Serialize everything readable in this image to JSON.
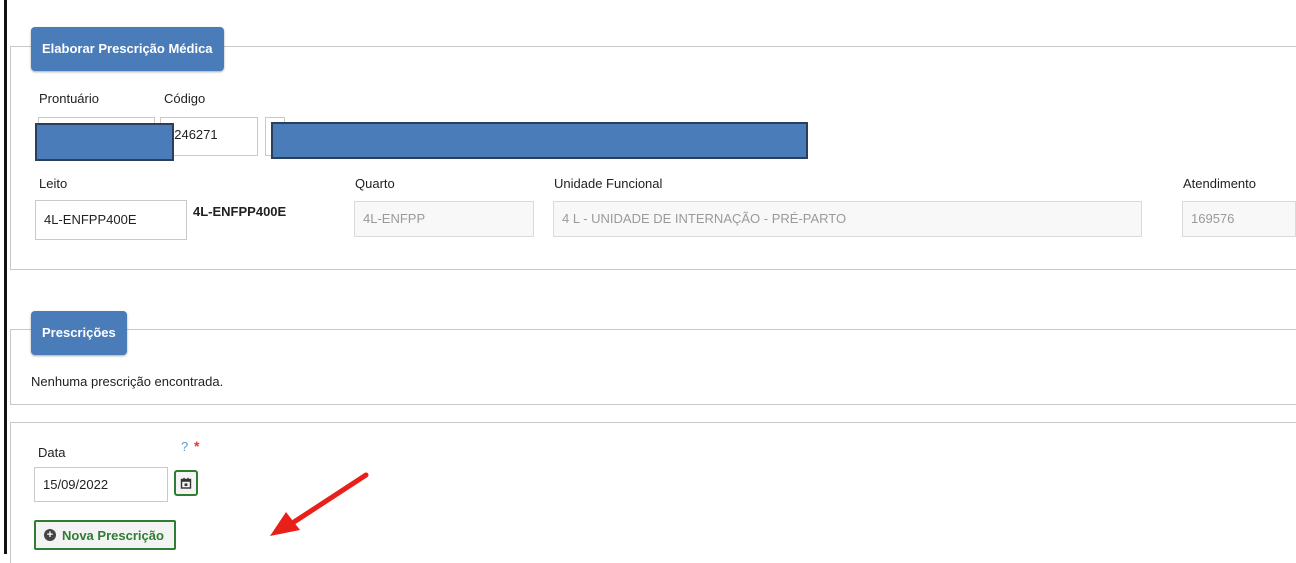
{
  "header": {
    "title": "Elaborar Prescrição Médica"
  },
  "patient": {
    "prontuario_label": "Prontuário",
    "codigo_label": "Código",
    "codigo_value": "3246271"
  },
  "bed": {
    "leito_label": "Leito",
    "leito_value": "4L-ENFPP400E",
    "leito_desc": "4L-ENFPP400E",
    "quarto_label": "Quarto",
    "quarto_value": "4L-ENFPP",
    "unidade_label": "Unidade Funcional",
    "unidade_value": "4 L - UNIDADE DE INTERNAÇÃO - PRÉ-PARTO",
    "atendimento_label": "Atendimento",
    "atendimento_value": "169576"
  },
  "prescricoes": {
    "title": "Prescrições",
    "empty_message": "Nenhuma prescrição encontrada."
  },
  "form": {
    "data_label": "Data",
    "help_glyph": "?",
    "required_glyph": "*",
    "data_value": "15/09/2022",
    "new_button_label": "Nova Prescrição"
  },
  "colors": {
    "legend_bg": "#4a7cba",
    "button_border": "#2e7d32",
    "arrow": "#e8201a"
  },
  "icons": {
    "calendar": "calendar-icon",
    "plus": "plus-circle-icon",
    "arrow": "red-arrow-annotation"
  }
}
